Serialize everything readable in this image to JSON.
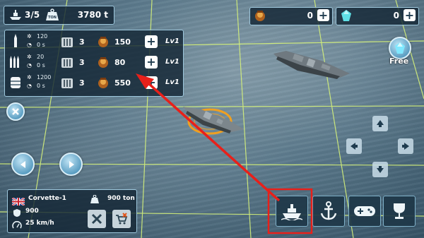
{
  "top_bar": {
    "ship_count": "3/5",
    "ship_icon": "ship-icon",
    "weight_icon": "weight-ton-icon",
    "weight_unit_label": "TON",
    "tonnage": "3780 t"
  },
  "currency": {
    "gold_icon": "gold-pot-icon",
    "gold_value": "0",
    "gem_icon": "gem-icon",
    "gem_value": "0",
    "free_label": "Free"
  },
  "ammo": [
    {
      "icon": "shell-icon",
      "stat1": "120",
      "stat2": "0 s",
      "count": "3",
      "cost": "150",
      "level": "Lv1"
    },
    {
      "icon": "missile-icon",
      "stat1": "20",
      "stat2": "0 s",
      "count": "3",
      "cost": "80",
      "level": "Lv1"
    },
    {
      "icon": "depth-charge-icon",
      "stat1": "1200",
      "stat2": "0 s",
      "count": "3",
      "cost": "550",
      "level": "Lv1"
    }
  ],
  "ship_info": {
    "flag": "uk-flag-icon",
    "name": "Corvette-1",
    "ton_icon": "ton-icon",
    "tonnage": "900 ton",
    "armor": "900",
    "speed": "25 km/h"
  },
  "bottom_tabs": [
    {
      "name": "tab-ships",
      "icon": "ship-icon"
    },
    {
      "name": "tab-anchor",
      "icon": "anchor-icon"
    },
    {
      "name": "tab-controller",
      "icon": "gamepad-icon"
    },
    {
      "name": "tab-trophy",
      "icon": "trophy-icon"
    }
  ],
  "colors": {
    "panel_bg": "#14263A",
    "panel_border": "#9EC8DD",
    "highlight_red": "#E8201A",
    "grid_line": "#D6F27A"
  }
}
